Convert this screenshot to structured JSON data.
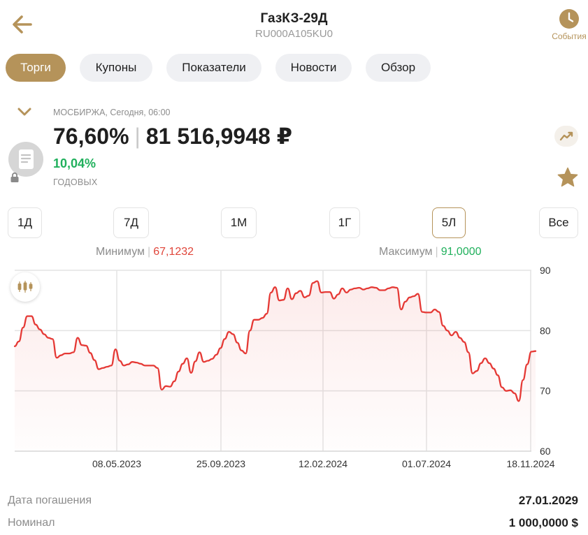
{
  "header": {
    "title": "ГазКЗ-29Д",
    "isin": "RU000A105KU0",
    "events_label": "События",
    "back_icon": "arrow-left-icon",
    "events_icon": "clock-icon"
  },
  "tabs": [
    {
      "label": "Торги",
      "active": true
    },
    {
      "label": "Купоны",
      "active": false
    },
    {
      "label": "Показатели",
      "active": false
    },
    {
      "label": "Новости",
      "active": false
    },
    {
      "label": "Обзор",
      "active": false
    }
  ],
  "quote": {
    "exchange_line": "МОСБИРЖА, Сегодня, 06:00",
    "price_pct": "76,60%",
    "price_rub": "81 516,9948 ₽",
    "yield": "10,04%",
    "yield_label": "ГОДОВЫХ"
  },
  "periods": [
    {
      "label": "1Д",
      "active": false
    },
    {
      "label": "7Д",
      "active": false
    },
    {
      "label": "1М",
      "active": false
    },
    {
      "label": "1Г",
      "active": false
    },
    {
      "label": "5Л",
      "active": true
    },
    {
      "label": "Все",
      "active": false
    }
  ],
  "range": {
    "min_label": "Минимум",
    "min_value": "67,1232",
    "max_label": "Максимум",
    "max_value": "91,0000"
  },
  "chart_data": {
    "type": "area",
    "ylim": [
      60,
      90
    ],
    "y_ticks": [
      "90",
      "80",
      "70",
      "60"
    ],
    "x_ticks": [
      "08.05.2023",
      "25.09.2023",
      "12.02.2024",
      "01.07.2024",
      "18.11.2024"
    ],
    "series": [
      {
        "values": [
          77.4,
          78.2,
          80.5,
          82.4,
          82.4,
          81.0,
          80.2,
          79.4,
          78.8,
          78.6,
          75.5,
          75.9,
          76.2,
          76.2,
          76.4,
          78.8,
          77.6,
          77.5,
          76.3,
          75.1,
          73.6,
          73.8,
          74.0,
          74.2,
          76.9,
          75.0,
          74.2,
          74.4,
          74.8,
          74.7,
          74.5,
          74.2,
          74.2,
          74.2,
          73.8,
          70.2,
          70.8,
          70.7,
          71.6,
          73.2,
          74.5,
          75.4,
          73.0,
          74.9,
          76.4,
          74.8,
          75.0,
          75.3,
          76.0,
          77.1,
          78.6,
          79.8,
          79.4,
          78.0,
          76.7,
          76.2,
          80.0,
          81.8,
          81.8,
          82.1,
          82.8,
          86.3,
          87.2,
          85.0,
          85.1,
          87.0,
          85.2,
          86.2,
          86.6,
          85.5,
          85.8,
          87.9,
          88.2,
          86.3,
          86.4,
          86.4,
          85.3,
          86.0,
          87.0,
          86.3,
          86.8,
          87.0,
          87.1,
          86.8,
          87.0,
          87.2,
          87.1,
          86.7,
          86.7,
          87.0,
          87.2,
          87.1,
          83.5,
          84.8,
          85.5,
          85.7,
          86.1,
          83.1,
          83.0,
          83.0,
          83.5,
          83.1,
          80.8,
          80.0,
          79.2,
          79.8,
          78.8,
          78.1,
          76.4,
          72.9,
          73.3,
          74.6,
          75.4,
          74.6,
          73.7,
          72.6,
          70.6,
          70.0,
          70.1,
          69.6,
          68.3,
          71.8,
          74.4,
          76.5,
          76.6
        ]
      }
    ]
  },
  "info": [
    {
      "label": "Дата погашения",
      "value": "27.01.2029"
    },
    {
      "label": "Номинал",
      "value": "1 000,0000 $"
    }
  ],
  "colors": {
    "accent": "#b5935a",
    "line": "#e53935",
    "positive": "#20b05c",
    "negative": "#e0453a"
  }
}
